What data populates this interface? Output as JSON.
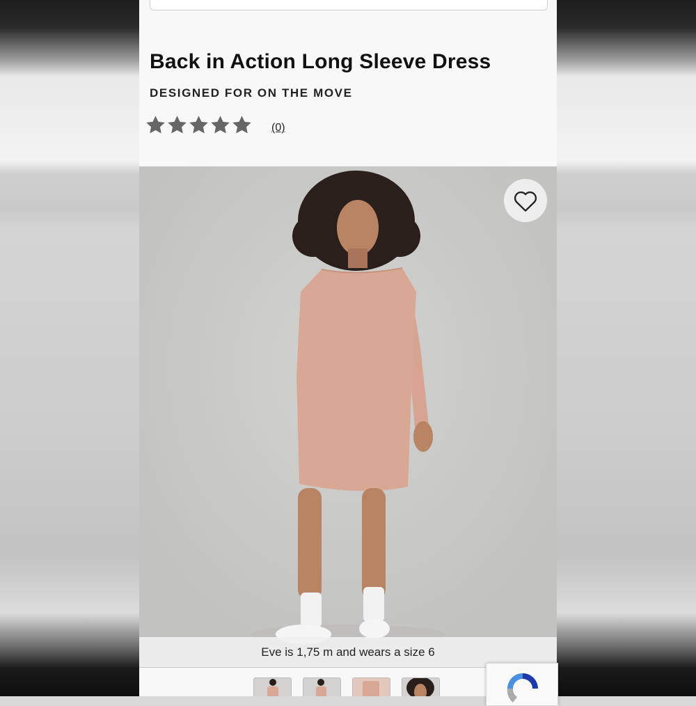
{
  "product": {
    "title": "Back in Action Long Sleeve Dress",
    "tagline": "DESIGNED FOR ON THE MOVE",
    "rating": 5,
    "review_count_label": "(0)"
  },
  "hero": {
    "favorite_icon": "heart-icon",
    "model_caption": "Eve is 1,75 m and wears a size 6"
  },
  "thumbnails": [
    {
      "name": "front-view"
    },
    {
      "name": "side-view"
    },
    {
      "name": "back-view"
    },
    {
      "name": "closeup-view"
    }
  ],
  "colors": {
    "dress": "#d9a894",
    "star": "#666666",
    "backdrop_gray": "#c8c8c6"
  }
}
